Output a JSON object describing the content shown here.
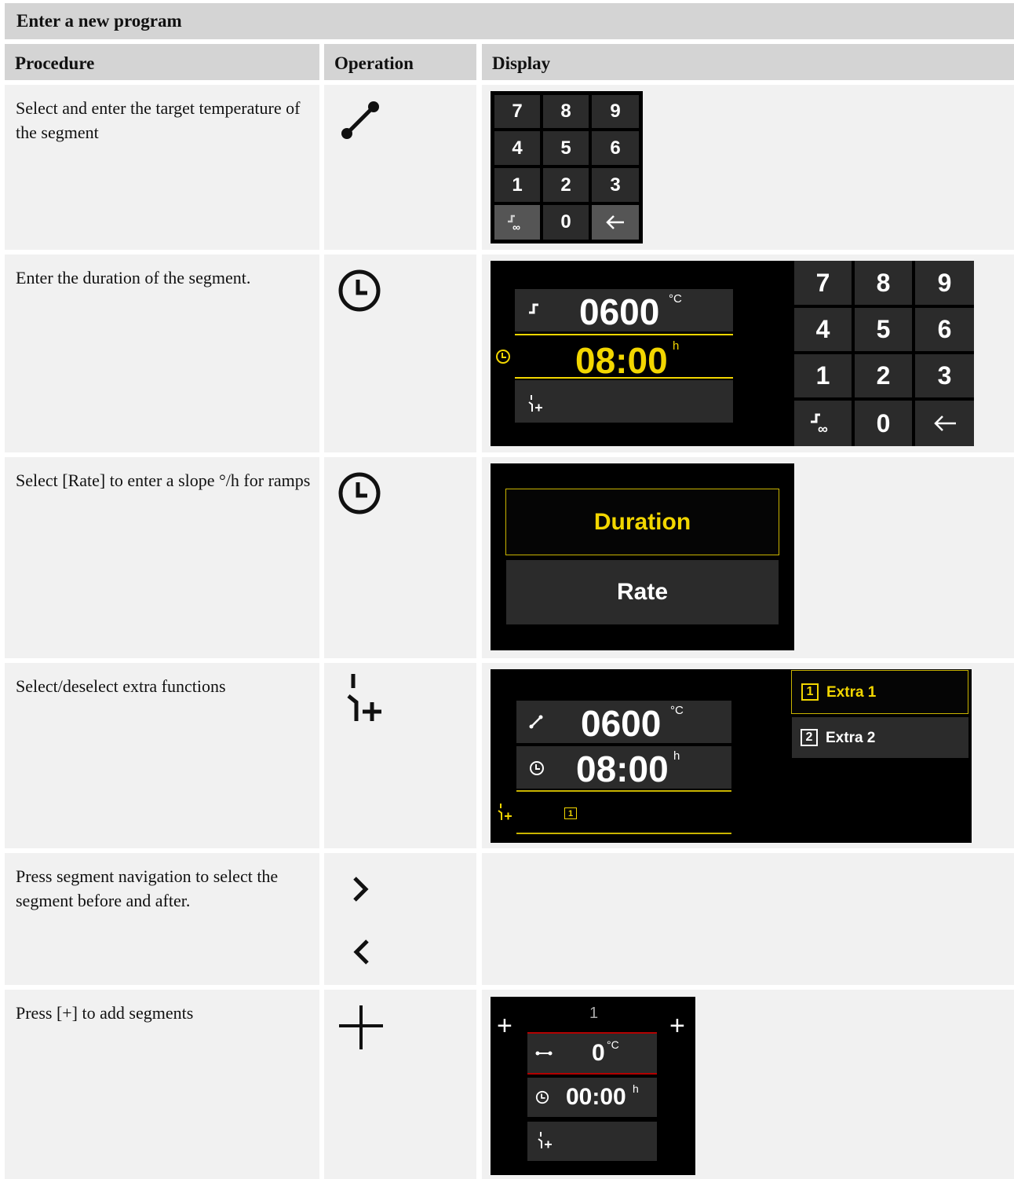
{
  "title": "Enter a new program",
  "headers": {
    "procedure": "Procedure",
    "operation": "Operation",
    "display": "Display"
  },
  "rows": [
    {
      "procedure": "Select and enter the target temperature of the segment",
      "operation_icon": "ramp-icon"
    },
    {
      "procedure": "Enter the duration of the segment.",
      "operation_icon": "clock-icon"
    },
    {
      "procedure": "Select [Rate] to enter a slope °/h for ramps",
      "operation_icon": "clock-icon"
    },
    {
      "procedure": "Select/deselect extra functions",
      "operation_icon": "extra-functions-icon"
    },
    {
      "procedure": "Press segment navigation to select the segment before and after.",
      "operation_icon": "chevron-icons"
    },
    {
      "procedure": "Press [+] to add segments",
      "operation_icon": "plus-icon"
    }
  ],
  "keypad": {
    "keys": [
      "7",
      "8",
      "9",
      "4",
      "5",
      "6",
      "1",
      "2",
      "3",
      "",
      "0",
      ""
    ],
    "special_icon": "ramp-infinity-icon",
    "back_icon": "arrow-left-icon"
  },
  "duration_screen": {
    "temperature": "0600",
    "temp_unit": "°C",
    "time": "08:00",
    "time_unit": "h",
    "accent": "#f2d600"
  },
  "duration_rate": {
    "duration": "Duration",
    "rate": "Rate"
  },
  "extras_screen": {
    "temperature": "0600",
    "temp_unit": "°C",
    "time": "08:00",
    "time_unit": "h",
    "selected_badge": "1",
    "options": [
      {
        "num": "1",
        "label": "Extra 1"
      },
      {
        "num": "2",
        "label": "Extra 2"
      }
    ]
  },
  "add_segment_screen": {
    "segment_number": "1",
    "temperature": "0",
    "temp_unit": "°C",
    "time": "00:00",
    "time_unit": "h",
    "plus": "+"
  }
}
